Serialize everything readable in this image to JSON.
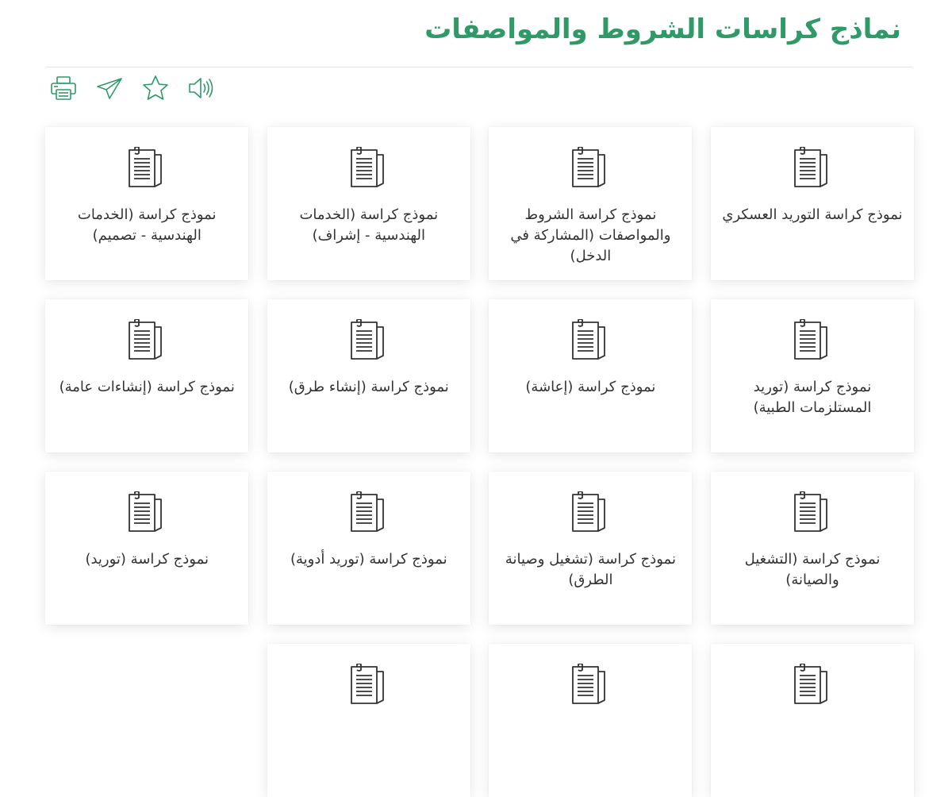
{
  "page": {
    "title": "نماذج كراسات الشروط والمواصفات"
  },
  "toolbar": {
    "items": [
      {
        "name": "print-icon"
      },
      {
        "name": "send-icon"
      },
      {
        "name": "star-icon"
      },
      {
        "name": "speaker-icon"
      }
    ]
  },
  "theme": {
    "accent": "#2f9a68",
    "icon_color": "#333333",
    "card_text": "#333333"
  },
  "cards": [
    {
      "label": "نموذج كراسة التوريد العسكري",
      "icon": "document-icon"
    },
    {
      "label": "نموذج كراسة الشروط والمواصفات (المشاركة في الدخل)",
      "icon": "document-icon"
    },
    {
      "label": "نموذج كراسة (الخدمات الهندسية - إشراف)",
      "icon": "document-icon"
    },
    {
      "label": "نموذج كراسة (الخدمات الهندسية - تصميم)",
      "icon": "document-icon"
    },
    {
      "label": "نموذج كراسة (توريد المستلزمات الطبية)",
      "icon": "document-icon"
    },
    {
      "label": "نموذج كراسة (إعاشة)",
      "icon": "document-icon"
    },
    {
      "label": "نموذج كراسة (إنشاء طرق)",
      "icon": "document-icon"
    },
    {
      "label": "نموذج كراسة (إنشاءات عامة)",
      "icon": "document-icon"
    },
    {
      "label": "نموذج كراسة (التشغيل والصيانة)",
      "icon": "document-icon"
    },
    {
      "label": "نموذج كراسة (تشغيل وصيانة الطرق)",
      "icon": "document-icon"
    },
    {
      "label": "نموذج كراسة (توريد أدوية)",
      "icon": "document-icon"
    },
    {
      "label": "نموذج كراسة (توريد)",
      "icon": "document-icon"
    },
    {
      "label": "",
      "icon": "document-icon"
    },
    {
      "label": "",
      "icon": "document-icon"
    },
    {
      "label": "",
      "icon": "document-icon"
    }
  ]
}
